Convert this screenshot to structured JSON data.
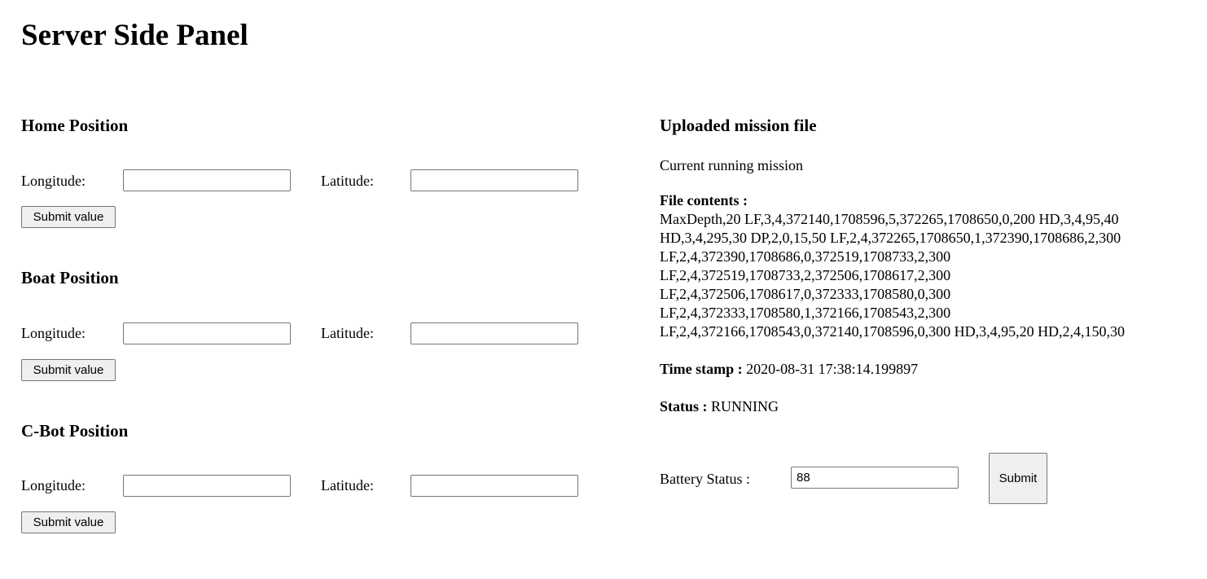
{
  "page": {
    "title": "Server Side Panel"
  },
  "home": {
    "heading": "Home Position",
    "longitude_label": "Longitude:",
    "latitude_label": "Latitude:",
    "longitude_value": "",
    "latitude_value": "",
    "submit_label": "Submit value"
  },
  "boat": {
    "heading": "Boat Position",
    "longitude_label": "Longitude:",
    "latitude_label": "Latitude:",
    "longitude_value": "",
    "latitude_value": "",
    "submit_label": "Submit value"
  },
  "cbot": {
    "heading": "C-Bot Position",
    "longitude_label": "Longitude:",
    "latitude_label": "Latitude:",
    "longitude_value": "",
    "latitude_value": "",
    "submit_label": "Submit value"
  },
  "mission": {
    "heading": "Uploaded mission file",
    "subtitle": "Current running mission",
    "file_contents_label": "File contents :",
    "file_contents": "MaxDepth,20 LF,3,4,372140,1708596,5,372265,1708650,0,200 HD,3,4,95,40 HD,3,4,295,30 DP,2,0,15,50 LF,2,4,372265,1708650,1,372390,1708686,2,300 LF,2,4,372390,1708686,0,372519,1708733,2,300 LF,2,4,372519,1708733,2,372506,1708617,2,300 LF,2,4,372506,1708617,0,372333,1708580,0,300 LF,2,4,372333,1708580,1,372166,1708543,2,300 LF,2,4,372166,1708543,0,372140,1708596,0,300 HD,3,4,95,20 HD,2,4,150,30",
    "timestamp_label": "Time stamp :",
    "timestamp_value": "2020-08-31 17:38:14.199897",
    "status_label": "Status :",
    "status_value": "RUNNING"
  },
  "battery": {
    "label": "Battery Status :",
    "value": "88",
    "submit_label": "Submit"
  }
}
